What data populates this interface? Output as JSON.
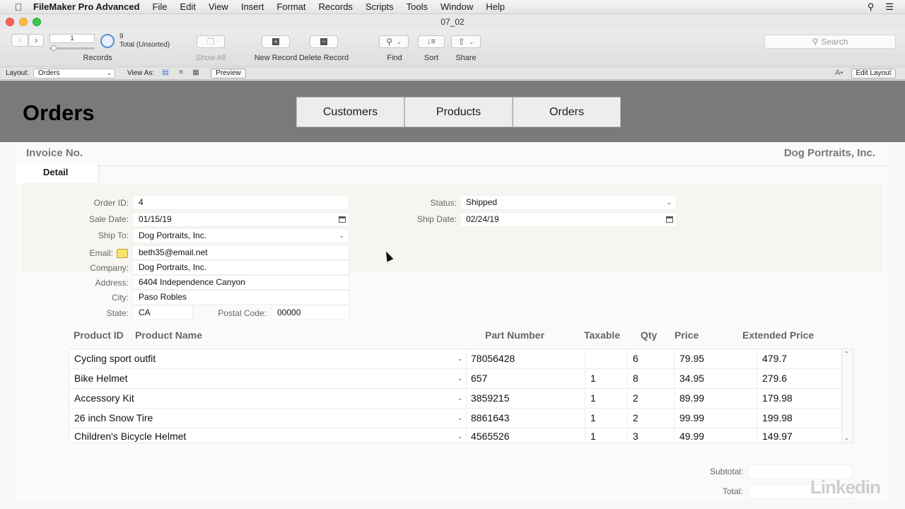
{
  "menubar": {
    "app_name": "FileMaker Pro Advanced",
    "items": [
      "File",
      "Edit",
      "View",
      "Insert",
      "Format",
      "Records",
      "Scripts",
      "Tools",
      "Window",
      "Help"
    ]
  },
  "window": {
    "title": "07_02"
  },
  "toolbar": {
    "record_number": "1",
    "record_count": "9",
    "record_status": "Total (Unsorted)",
    "records_label": "Records",
    "show_all_label": "Show All",
    "new_record_label": "New Record",
    "delete_record_label": "Delete Record",
    "find_label": "Find",
    "sort_label": "Sort",
    "share_label": "Share",
    "search_placeholder": "Search"
  },
  "layoutbar": {
    "layout_label": "Layout:",
    "layout_value": "Orders",
    "view_as_label": "View As:",
    "preview_label": "Preview",
    "edit_layout_label": "Edit Layout"
  },
  "header": {
    "title": "Orders",
    "nav": [
      "Customers",
      "Products",
      "Orders"
    ]
  },
  "invoice": {
    "invoice_label": "Invoice No.",
    "company_name": "Dog Portraits, Inc.",
    "tab_label": "Detail"
  },
  "fields": {
    "order_id_label": "Order ID:",
    "order_id": "4",
    "sale_date_label": "Sale Date:",
    "sale_date": "01/15/19",
    "ship_to_label": "Ship To:",
    "ship_to": "Dog Portraits, Inc.",
    "email_label": "Email:",
    "email": "beth35@email.net",
    "company_label": "Company:",
    "company": "Dog Portraits, Inc.",
    "address_label": "Address:",
    "address": "6404 Independence Canyon",
    "city_label": "City:",
    "city": "Paso Robles",
    "state_label": "State:",
    "state": "CA",
    "postal_label": "Postal Code:",
    "postal": "00000",
    "status_label": "Status:",
    "status": "Shipped",
    "ship_date_label": "Ship Date:",
    "ship_date": "02/24/19"
  },
  "portal": {
    "headers": {
      "product_id": "Product ID",
      "product_name": "Product Name",
      "part_number": "Part Number",
      "taxable": "Taxable",
      "qty": "Qty",
      "price": "Price",
      "extended_price": "Extended Price"
    },
    "rows": [
      {
        "name": "Cycling sport outfit",
        "part": "78056428",
        "taxable": "",
        "qty": "6",
        "price": "79.95",
        "ext": "479.7"
      },
      {
        "name": "Bike Helmet",
        "part": "657",
        "taxable": "1",
        "qty": "8",
        "price": "34.95",
        "ext": "279.6"
      },
      {
        "name": "Accessory Kit",
        "part": "3859215",
        "taxable": "1",
        "qty": "2",
        "price": "89.99",
        "ext": "179.98"
      },
      {
        "name": "26 inch Snow Tire",
        "part": "8861643",
        "taxable": "1",
        "qty": "2",
        "price": "99.99",
        "ext": "199.98"
      },
      {
        "name": "Children's Bicycle Helmet",
        "part": "4565526",
        "taxable": "1",
        "qty": "3",
        "price": "49.99",
        "ext": "149.97"
      }
    ]
  },
  "totals": {
    "subtotal_label": "Subtotal:",
    "subtotal": "",
    "total_label": "Total:",
    "total": ""
  },
  "watermark": "Linkedin"
}
